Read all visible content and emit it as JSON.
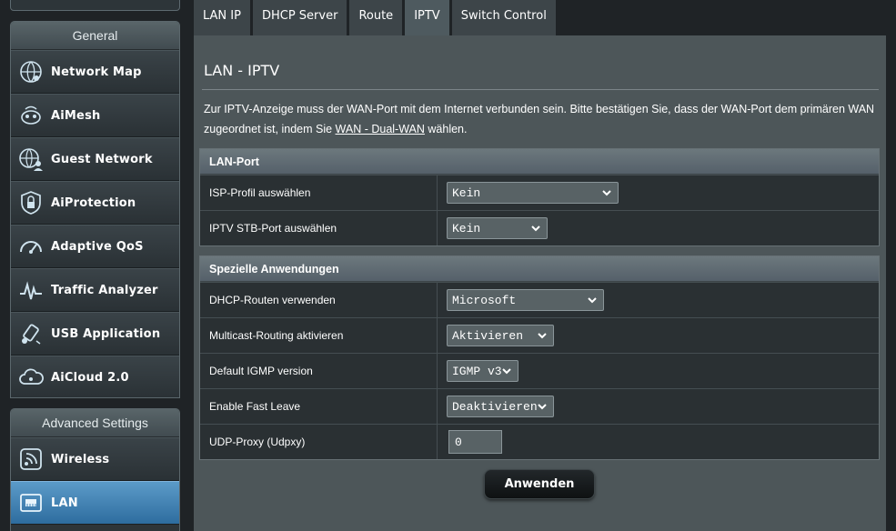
{
  "sidebar": {
    "general_header": "General",
    "general_items": [
      {
        "label": "Network Map",
        "icon": "network-map-icon"
      },
      {
        "label": "AiMesh",
        "icon": "aimesh-icon"
      },
      {
        "label": "Guest Network",
        "icon": "guest-network-icon"
      },
      {
        "label": "AiProtection",
        "icon": "aiprotection-icon"
      },
      {
        "label": "Adaptive QoS",
        "icon": "adaptive-qos-icon"
      },
      {
        "label": "Traffic Analyzer",
        "icon": "traffic-analyzer-icon"
      },
      {
        "label": "USB Application",
        "icon": "usb-application-icon"
      },
      {
        "label": "AiCloud 2.0",
        "icon": "aicloud-icon"
      }
    ],
    "advanced_header": "Advanced Settings",
    "advanced_items": [
      {
        "label": "Wireless",
        "icon": "wireless-icon"
      },
      {
        "label": "LAN",
        "icon": "lan-icon",
        "active": true
      }
    ]
  },
  "tabs": [
    {
      "label": "LAN IP"
    },
    {
      "label": "DHCP Server"
    },
    {
      "label": "Route"
    },
    {
      "label": "IPTV",
      "active": true
    },
    {
      "label": "Switch Control"
    }
  ],
  "page": {
    "title": "LAN - IPTV",
    "intro_before": "Zur IPTV-Anzeige muss der WAN-Port mit dem Internet verbunden sein. Bitte bestätigen Sie, dass der WAN-Port dem primären WAN zugeordnet ist, indem Sie ",
    "intro_link": "WAN - Dual-WAN",
    "intro_after": " wählen."
  },
  "lan_port": {
    "header": "LAN-Port",
    "isp_label": "ISP-Profil auswählen",
    "isp_value": "Kein",
    "stb_label": "IPTV STB-Port auswählen",
    "stb_value": "Kein"
  },
  "special": {
    "header": "Spezielle Anwendungen",
    "dhcp_label": "DHCP-Routen verwenden",
    "dhcp_value": "Microsoft",
    "multicast_label": "Multicast-Routing aktivieren",
    "multicast_value": "Aktivieren",
    "igmp_label": "Default IGMP version",
    "igmp_value": "IGMP v3",
    "fastleave_label": "Enable Fast Leave",
    "fastleave_value": "Deaktivieren",
    "udpxy_label": "UDP-Proxy (Udpxy)",
    "udpxy_value": "0"
  },
  "apply_label": "Anwenden",
  "colors": {
    "active_blue": "#3f84b8",
    "panel": "#4d5659",
    "background": "#1f2326"
  }
}
